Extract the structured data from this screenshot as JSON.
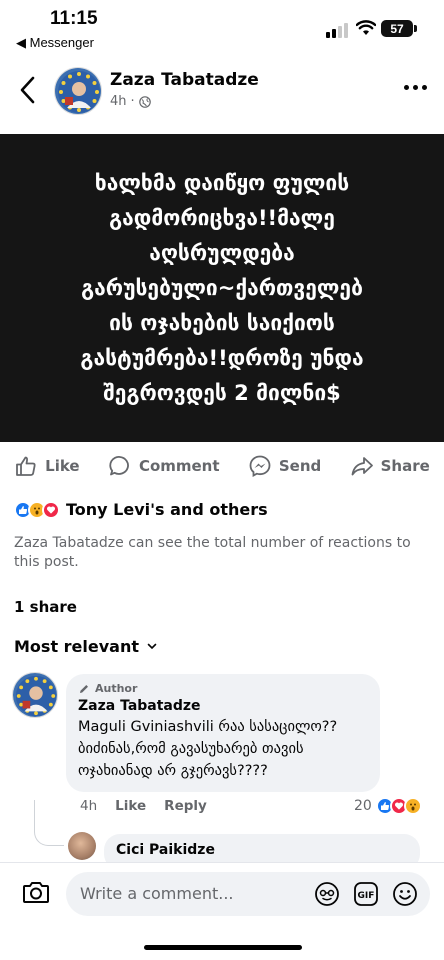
{
  "status_bar": {
    "time": "11:15",
    "back_app": "◀ Messenger",
    "battery": "57"
  },
  "header": {
    "author": "Zaza Tabatadze",
    "time": "4h",
    "separator": "·"
  },
  "post": {
    "text_lines": [
      "ხალხმა დაიწყო ფულის",
      "გადმორიცხვა!!მალე",
      "აღსრულდება",
      "გარუსებული~ქართველებ",
      "ის ოჯახების საიქიოს",
      "გასტუმრება!!დროზე უნდა",
      "შეგროვდეს 2 მილნი$"
    ]
  },
  "actions": {
    "like": "Like",
    "comment": "Comment",
    "send": "Send",
    "share": "Share"
  },
  "reactions": {
    "summary": "Tony Levi's and others"
  },
  "notice": "Zaza Tabatadze can see the total number of reactions to this post.",
  "shares": "1 share",
  "sort": {
    "label": "Most relevant"
  },
  "comment": {
    "badge": "Author",
    "author": "Zaza Tabatadze",
    "lines": [
      "Maguli Gviniashvili რაა სასაცილო??",
      "ბიძინას,რომ გავასუხარებ თავის",
      "ოჯახიანად არ გჯერავს????"
    ],
    "time": "4h",
    "like": "Like",
    "reply": "Reply",
    "reaction_count": "20"
  },
  "reply": {
    "author": "Cici Paikidze"
  },
  "composer": {
    "placeholder": "Write a comment...",
    "gif": "GIF"
  },
  "colors": {
    "like_blue": "#1877f2",
    "love_red": "#f02849",
    "haha_yellow": "#f7b125",
    "secondary": "#65676b"
  }
}
